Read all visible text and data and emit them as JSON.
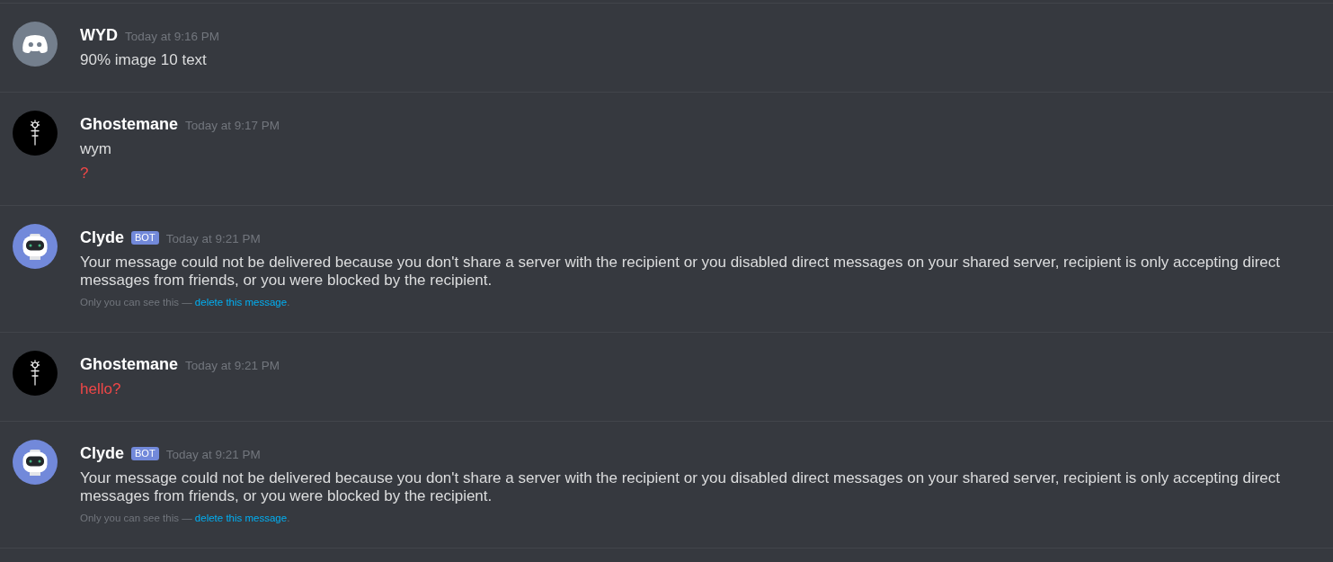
{
  "messages": [
    {
      "author": "WYD",
      "timestamp": "Today at 9:16 PM",
      "avatar": {
        "kind": "default"
      },
      "lines": [
        {
          "text": "90% image 10 text",
          "failed": false
        }
      ]
    },
    {
      "author": "Ghostemane",
      "timestamp": "Today at 9:17 PM",
      "avatar": {
        "kind": "symbol"
      },
      "lines": [
        {
          "text": "wym",
          "failed": false
        },
        {
          "text": "?",
          "failed": true
        }
      ]
    },
    {
      "author": "Clyde",
      "badge": "BOT",
      "timestamp": "Today at 9:21 PM",
      "avatar": {
        "kind": "robot"
      },
      "lines": [
        {
          "text": "Your message could not be delivered because you don't share a server with the recipient or you disabled direct messages on your shared server, recipient is only accepting direct messages from friends, or you were blocked by the recipient.",
          "failed": false
        }
      ],
      "notice": {
        "text": "Only you can see this —",
        "link": "delete this message",
        "suffix": "."
      }
    },
    {
      "author": "Ghostemane",
      "timestamp": "Today at 9:21 PM",
      "avatar": {
        "kind": "symbol"
      },
      "lines": [
        {
          "text": "hello?",
          "failed": true
        }
      ]
    },
    {
      "author": "Clyde",
      "badge": "BOT",
      "timestamp": "Today at 9:21 PM",
      "avatar": {
        "kind": "robot"
      },
      "lines": [
        {
          "text": "Your message could not be delivered because you don't share a server with the recipient or you disabled direct messages on your shared server, recipient is only accepting direct messages from friends, or you were blocked by the recipient.",
          "failed": false
        }
      ],
      "notice": {
        "text": "Only you can see this —",
        "link": "delete this message",
        "suffix": "."
      }
    }
  ]
}
